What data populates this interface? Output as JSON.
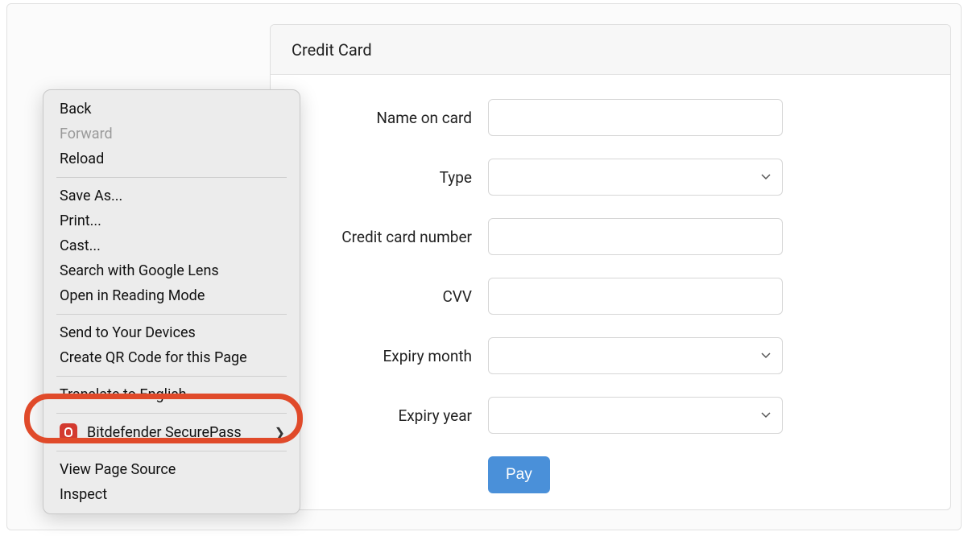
{
  "panel": {
    "title": "Credit Card"
  },
  "form": {
    "name_label": "Name on card",
    "name_value": "",
    "type_label": "Type",
    "type_value": "",
    "ccnum_label": "Credit card number",
    "ccnum_value": "",
    "cvv_label": "CVV",
    "cvv_value": "",
    "exp_month_label": "Expiry month",
    "exp_month_value": "",
    "exp_year_label": "Expiry year",
    "exp_year_value": "",
    "pay_label": "Pay"
  },
  "context_menu": {
    "back": "Back",
    "forward": "Forward",
    "reload": "Reload",
    "save_as": "Save As...",
    "print": "Print...",
    "cast": "Cast...",
    "search_lens": "Search with Google Lens",
    "reading_mode": "Open in Reading Mode",
    "send_devices": "Send to Your Devices",
    "create_qr": "Create QR Code for this Page",
    "translate": "Translate to English",
    "securepass": "Bitdefender SecurePass",
    "view_source": "View Page Source",
    "inspect": "Inspect"
  }
}
